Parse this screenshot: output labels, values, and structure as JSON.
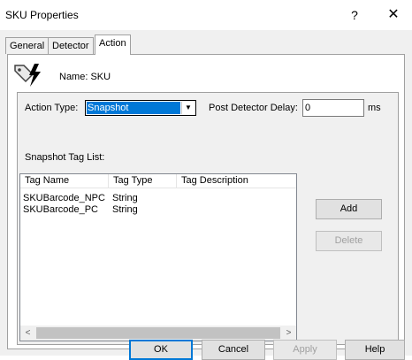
{
  "window": {
    "title": "SKU Properties",
    "help_glyph": "?",
    "close_glyph": "✕"
  },
  "tabs": [
    {
      "label": "General",
      "active": false
    },
    {
      "label": "Detector",
      "active": false
    },
    {
      "label": "Action",
      "active": true
    }
  ],
  "header": {
    "name_label": "Name: SKU",
    "icon": "sku-tag-lightning-icon"
  },
  "action": {
    "action_type_label": "Action Type:",
    "action_type_value": "Snapshot",
    "post_delay_label": "Post Detector Delay:",
    "post_delay_value": "0",
    "post_delay_unit": "ms",
    "snapshot_list_label": "Snapshot Tag List:"
  },
  "tag_list": {
    "columns": [
      "Tag Name",
      "Tag Type",
      "Tag Description"
    ],
    "rows": [
      {
        "name": "SKUBarcode_NPC",
        "type": "String",
        "description": ""
      },
      {
        "name": "SKUBarcode_PC",
        "type": "String",
        "description": ""
      }
    ]
  },
  "side_buttons": {
    "add": "Add",
    "delete": "Delete"
  },
  "footer": {
    "ok": "OK",
    "cancel": "Cancel",
    "apply": "Apply",
    "help": "Help"
  }
}
